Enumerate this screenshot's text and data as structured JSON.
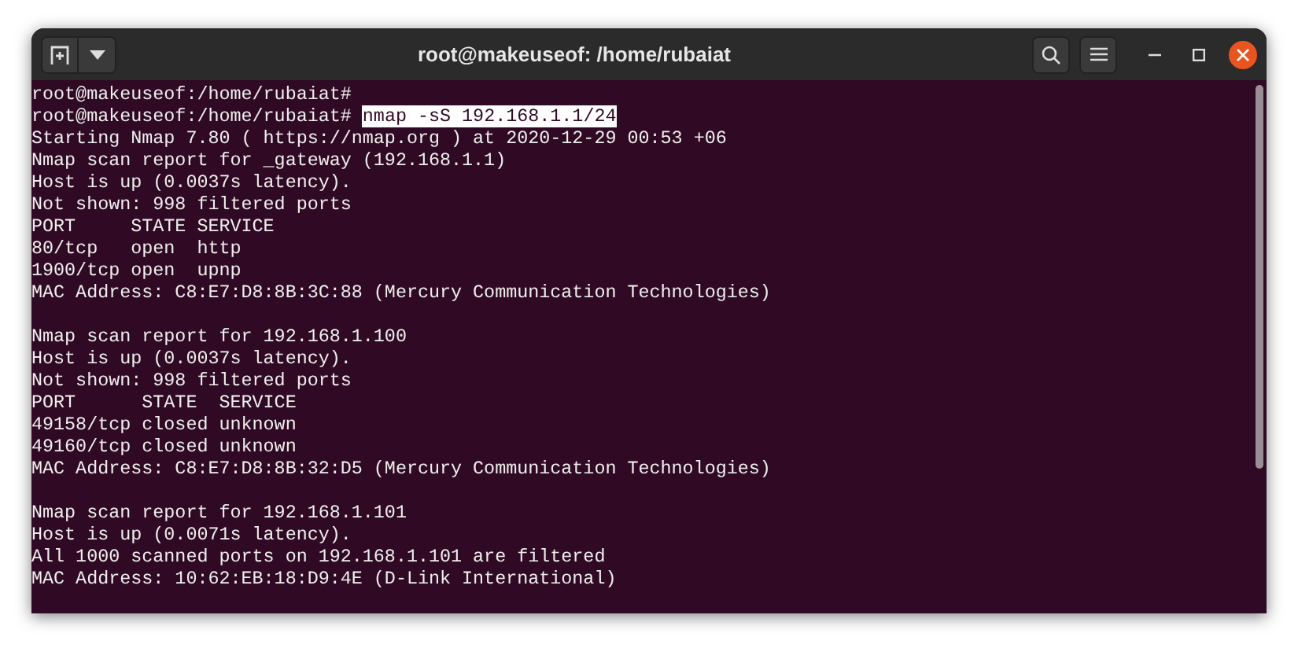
{
  "window": {
    "title": "root@makeuseof: /home/rubaiat"
  },
  "lines": [
    {
      "kind": "prompt",
      "prompt": "root@makeuseof:/home/rubaiat#"
    },
    {
      "kind": "prompt",
      "prompt": "root@makeuseof:/home/rubaiat#",
      "command": "nmap -sS 192.168.1.1/24",
      "selected": true
    },
    {
      "kind": "output",
      "text": "Starting Nmap 7.80 ( https://nmap.org ) at 2020-12-29 00:53 +06"
    },
    {
      "kind": "output",
      "text": "Nmap scan report for _gateway (192.168.1.1)"
    },
    {
      "kind": "output",
      "text": "Host is up (0.0037s latency)."
    },
    {
      "kind": "output",
      "text": "Not shown: 998 filtered ports"
    },
    {
      "kind": "output",
      "text": "PORT     STATE SERVICE"
    },
    {
      "kind": "output",
      "text": "80/tcp   open  http"
    },
    {
      "kind": "output",
      "text": "1900/tcp open  upnp"
    },
    {
      "kind": "output",
      "text": "MAC Address: C8:E7:D8:8B:3C:88 (Mercury Communication Technologies)"
    },
    {
      "kind": "blank"
    },
    {
      "kind": "output",
      "text": "Nmap scan report for 192.168.1.100"
    },
    {
      "kind": "output",
      "text": "Host is up (0.0037s latency)."
    },
    {
      "kind": "output",
      "text": "Not shown: 998 filtered ports"
    },
    {
      "kind": "output",
      "text": "PORT      STATE  SERVICE"
    },
    {
      "kind": "output",
      "text": "49158/tcp closed unknown"
    },
    {
      "kind": "output",
      "text": "49160/tcp closed unknown"
    },
    {
      "kind": "output",
      "text": "MAC Address: C8:E7:D8:8B:32:D5 (Mercury Communication Technologies)"
    },
    {
      "kind": "blank"
    },
    {
      "kind": "output",
      "text": "Nmap scan report for 192.168.1.101"
    },
    {
      "kind": "output",
      "text": "Host is up (0.0071s latency)."
    },
    {
      "kind": "output",
      "text": "All 1000 scanned ports on 192.168.1.101 are filtered"
    },
    {
      "kind": "output",
      "text": "MAC Address: 10:62:EB:18:D9:4E (D-Link International)"
    }
  ]
}
